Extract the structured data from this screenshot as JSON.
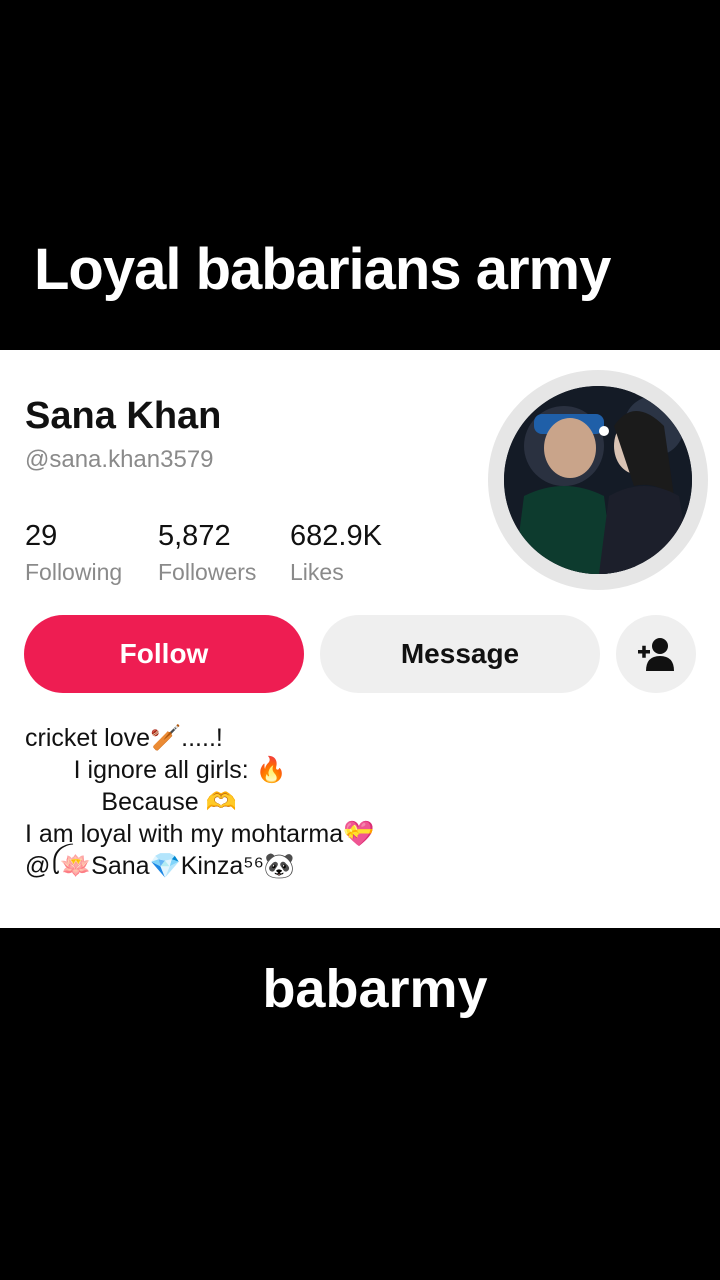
{
  "top_caption": "Loyal babarians army",
  "bottom_caption": "babarmy",
  "profile": {
    "name": "Sana Khan",
    "handle": "@sana.khan3579",
    "stats": [
      {
        "value": "29",
        "label": "Following"
      },
      {
        "value": "5,872",
        "label": "Followers"
      },
      {
        "value": "682.9K",
        "label": "Likes"
      }
    ],
    "buttons": {
      "follow": "Follow",
      "message": "Message",
      "add_friend_icon": "add-person-icon"
    },
    "bio": [
      "cricket love🏏.....!",
      "       I ignore all girls: 🔥",
      "           Because 🫶",
      "I am loyal with my mohtarma💝",
      "@ꪶ🪷Sana💎Kinza⁵⁶🐼"
    ]
  },
  "colors": {
    "follow_button": "#ee1d52",
    "secondary_button": "#efefef",
    "muted_text": "#8a8a8a",
    "caption_background": "#000000"
  }
}
